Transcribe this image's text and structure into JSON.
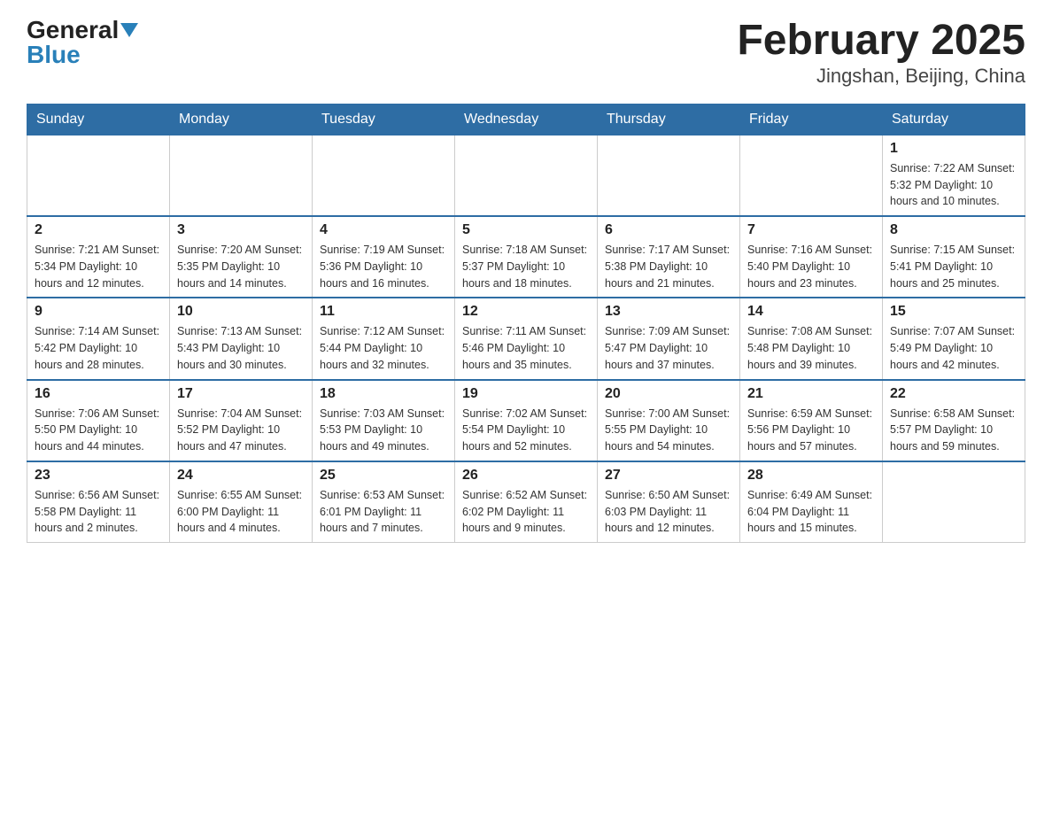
{
  "logo": {
    "general": "General",
    "blue": "Blue"
  },
  "title": "February 2025",
  "subtitle": "Jingshan, Beijing, China",
  "weekdays": [
    "Sunday",
    "Monday",
    "Tuesday",
    "Wednesday",
    "Thursday",
    "Friday",
    "Saturday"
  ],
  "weeks": [
    [
      {
        "day": "",
        "info": ""
      },
      {
        "day": "",
        "info": ""
      },
      {
        "day": "",
        "info": ""
      },
      {
        "day": "",
        "info": ""
      },
      {
        "day": "",
        "info": ""
      },
      {
        "day": "",
        "info": ""
      },
      {
        "day": "1",
        "info": "Sunrise: 7:22 AM\nSunset: 5:32 PM\nDaylight: 10 hours and 10 minutes."
      }
    ],
    [
      {
        "day": "2",
        "info": "Sunrise: 7:21 AM\nSunset: 5:34 PM\nDaylight: 10 hours and 12 minutes."
      },
      {
        "day": "3",
        "info": "Sunrise: 7:20 AM\nSunset: 5:35 PM\nDaylight: 10 hours and 14 minutes."
      },
      {
        "day": "4",
        "info": "Sunrise: 7:19 AM\nSunset: 5:36 PM\nDaylight: 10 hours and 16 minutes."
      },
      {
        "day": "5",
        "info": "Sunrise: 7:18 AM\nSunset: 5:37 PM\nDaylight: 10 hours and 18 minutes."
      },
      {
        "day": "6",
        "info": "Sunrise: 7:17 AM\nSunset: 5:38 PM\nDaylight: 10 hours and 21 minutes."
      },
      {
        "day": "7",
        "info": "Sunrise: 7:16 AM\nSunset: 5:40 PM\nDaylight: 10 hours and 23 minutes."
      },
      {
        "day": "8",
        "info": "Sunrise: 7:15 AM\nSunset: 5:41 PM\nDaylight: 10 hours and 25 minutes."
      }
    ],
    [
      {
        "day": "9",
        "info": "Sunrise: 7:14 AM\nSunset: 5:42 PM\nDaylight: 10 hours and 28 minutes."
      },
      {
        "day": "10",
        "info": "Sunrise: 7:13 AM\nSunset: 5:43 PM\nDaylight: 10 hours and 30 minutes."
      },
      {
        "day": "11",
        "info": "Sunrise: 7:12 AM\nSunset: 5:44 PM\nDaylight: 10 hours and 32 minutes."
      },
      {
        "day": "12",
        "info": "Sunrise: 7:11 AM\nSunset: 5:46 PM\nDaylight: 10 hours and 35 minutes."
      },
      {
        "day": "13",
        "info": "Sunrise: 7:09 AM\nSunset: 5:47 PM\nDaylight: 10 hours and 37 minutes."
      },
      {
        "day": "14",
        "info": "Sunrise: 7:08 AM\nSunset: 5:48 PM\nDaylight: 10 hours and 39 minutes."
      },
      {
        "day": "15",
        "info": "Sunrise: 7:07 AM\nSunset: 5:49 PM\nDaylight: 10 hours and 42 minutes."
      }
    ],
    [
      {
        "day": "16",
        "info": "Sunrise: 7:06 AM\nSunset: 5:50 PM\nDaylight: 10 hours and 44 minutes."
      },
      {
        "day": "17",
        "info": "Sunrise: 7:04 AM\nSunset: 5:52 PM\nDaylight: 10 hours and 47 minutes."
      },
      {
        "day": "18",
        "info": "Sunrise: 7:03 AM\nSunset: 5:53 PM\nDaylight: 10 hours and 49 minutes."
      },
      {
        "day": "19",
        "info": "Sunrise: 7:02 AM\nSunset: 5:54 PM\nDaylight: 10 hours and 52 minutes."
      },
      {
        "day": "20",
        "info": "Sunrise: 7:00 AM\nSunset: 5:55 PM\nDaylight: 10 hours and 54 minutes."
      },
      {
        "day": "21",
        "info": "Sunrise: 6:59 AM\nSunset: 5:56 PM\nDaylight: 10 hours and 57 minutes."
      },
      {
        "day": "22",
        "info": "Sunrise: 6:58 AM\nSunset: 5:57 PM\nDaylight: 10 hours and 59 minutes."
      }
    ],
    [
      {
        "day": "23",
        "info": "Sunrise: 6:56 AM\nSunset: 5:58 PM\nDaylight: 11 hours and 2 minutes."
      },
      {
        "day": "24",
        "info": "Sunrise: 6:55 AM\nSunset: 6:00 PM\nDaylight: 11 hours and 4 minutes."
      },
      {
        "day": "25",
        "info": "Sunrise: 6:53 AM\nSunset: 6:01 PM\nDaylight: 11 hours and 7 minutes."
      },
      {
        "day": "26",
        "info": "Sunrise: 6:52 AM\nSunset: 6:02 PM\nDaylight: 11 hours and 9 minutes."
      },
      {
        "day": "27",
        "info": "Sunrise: 6:50 AM\nSunset: 6:03 PM\nDaylight: 11 hours and 12 minutes."
      },
      {
        "day": "28",
        "info": "Sunrise: 6:49 AM\nSunset: 6:04 PM\nDaylight: 11 hours and 15 minutes."
      },
      {
        "day": "",
        "info": ""
      }
    ]
  ]
}
